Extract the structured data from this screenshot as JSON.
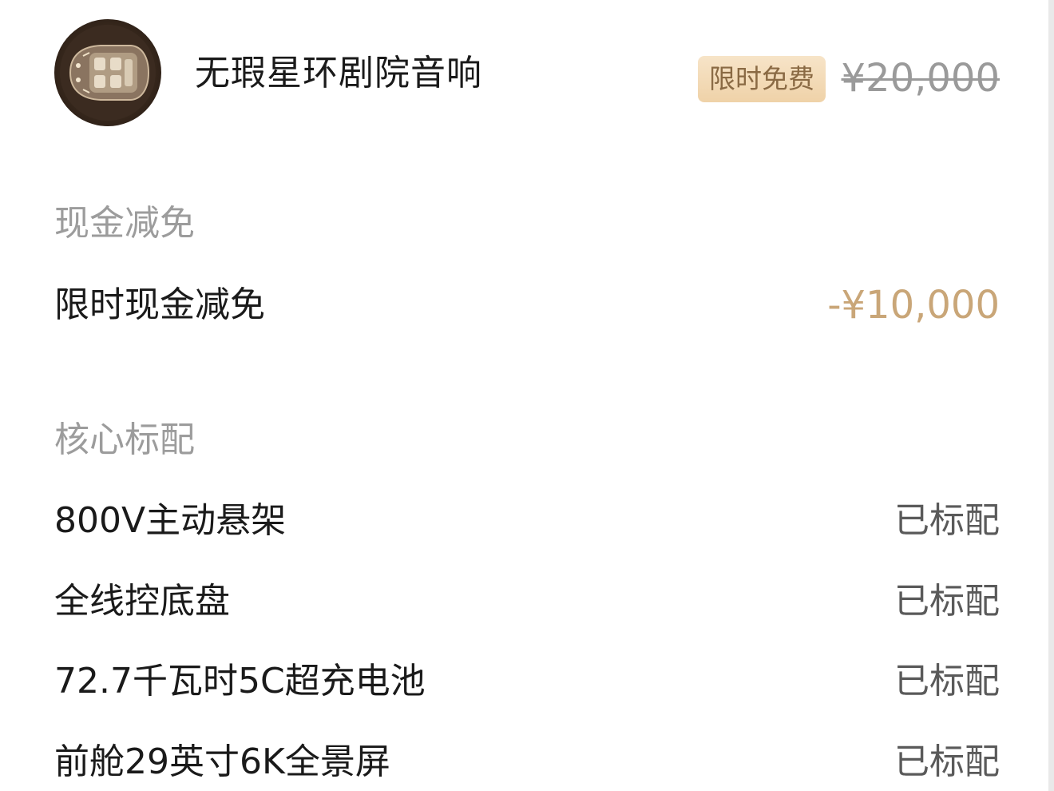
{
  "product": {
    "name": "无瑕星环剧院音响",
    "image_icon": "car-interior-thumbnail",
    "badge": "限时免费",
    "original_price": "¥20,000"
  },
  "cash_discount": {
    "title": "现金减免",
    "item": {
      "label": "限时现金减免",
      "value": "-¥10,000"
    }
  },
  "core_features": {
    "title": "核心标配",
    "items": [
      {
        "label": "800V主动悬架",
        "status": "已标配"
      },
      {
        "label": "全线控底盘",
        "status": "已标配"
      },
      {
        "label": "72.7千瓦时5C超充电池",
        "status": "已标配"
      },
      {
        "label": "前舱29英寸6K全景屏",
        "status": "已标配"
      }
    ]
  },
  "colors": {
    "accent_gold": "#c9a678",
    "badge_bg": "#efd2a8",
    "badge_text": "#8a6a44",
    "muted": "#9c9c9c"
  }
}
